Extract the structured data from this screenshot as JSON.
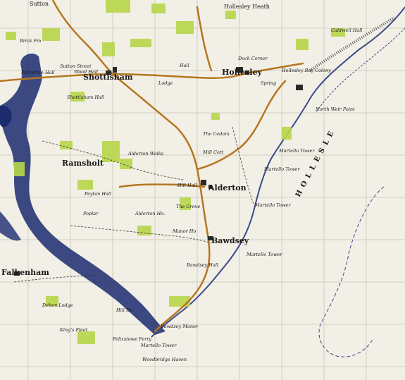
{
  "map": {
    "colors": {
      "paper": "#f2efe6",
      "woodland": "#b8d64a",
      "water": "#1c2a6e",
      "road": "#b5761f",
      "grid": "#c9c4b6",
      "coast": "#3a4a8a",
      "ink": "#1a1a1a"
    },
    "labels": {
      "sutton": "Sutton",
      "hollesley_heath": "Hollesley Heath",
      "hollesley": "Hollesley",
      "shottisham": "Shottisham",
      "alderton": "Alderton",
      "ramsholt": "Ramsholt",
      "bawdsey": "Bawdsey",
      "falkenham": "Falkenham",
      "sea_name": "HOLLESLE",
      "north_weir_point": "North Weir Point",
      "hollesley_bay": "Hollesley Bay Colony",
      "dock_corner": "Dock Corner",
      "spring": "Spring",
      "the_cedars": "The Cedars",
      "mill_cott": "Mill Cott",
      "martello_1": "Martello Tower",
      "martello_2": "Martello Tower",
      "martello_3": "Martello Tower",
      "martello_4": "Martello Tower",
      "martello_5": "Martello Tower",
      "alderton_walks": "Alderton Walks",
      "peyton_hall": "Peyton Hall",
      "poplar": "Poplar",
      "alderton_ho": "Alderton Ho.",
      "manor_ho": "Manor Ho",
      "bawdsey_hall": "Bawdsey Hall",
      "bawdsey_manor": "Bawdsey Manor",
      "deben_lodge": "Deben Lodge",
      "felixstowe_ferry": "Felixstowe Ferry",
      "woodbridge_haven": "Woodbridge Haven",
      "sutton_street": "Sutton Street",
      "wood_hall": "Wood Hall",
      "shottisham_hall": "Shottisham Hall",
      "pettistree_hall": "Pettistree Hall",
      "brickfm": "Brick Fm",
      "rous_lodge": "Lodge",
      "the_grove": "The Grove",
      "hill_hall": "Hill Hall",
      "caldwell_hall": "Caldwell Hall",
      "kings_fleet": "King's Fleet",
      "hill_ho": "Hill Ho.",
      "mill_hall": "Hall"
    }
  }
}
